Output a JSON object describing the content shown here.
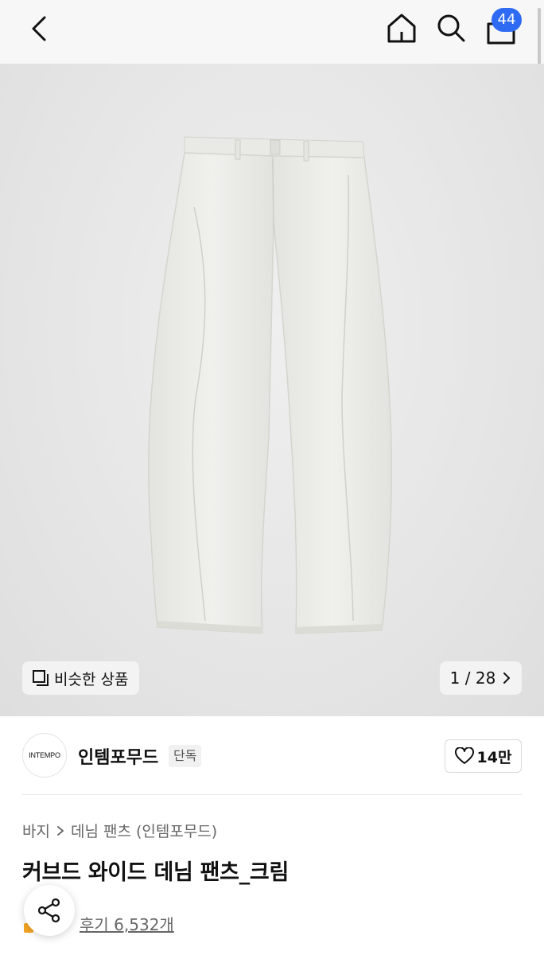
{
  "header": {
    "cart_count": "44"
  },
  "gallery": {
    "similar_label": "비슷한 상품",
    "pager_text": "1 / 28"
  },
  "brand": {
    "logo_text": "INTEMPO",
    "name": "인템포무드",
    "exclusive_badge": "단독",
    "likes": "14만"
  },
  "breadcrumb": {
    "category": "바지",
    "subcategory": "데님 팬츠 (인템포무드)"
  },
  "product": {
    "title": "커브드 와이드 데님 팬츠_크림",
    "reviews": "후기 6,532개"
  },
  "icons": [
    "back-arrow-icon",
    "home-icon",
    "search-icon",
    "shopping-bag-icon",
    "similar-items-icon",
    "chevron-right-icon",
    "heart-icon",
    "share-icon"
  ],
  "colors": {
    "badge": "#2f6bf2",
    "hero_background": "#e6e6e6",
    "pants": "#ececea"
  }
}
